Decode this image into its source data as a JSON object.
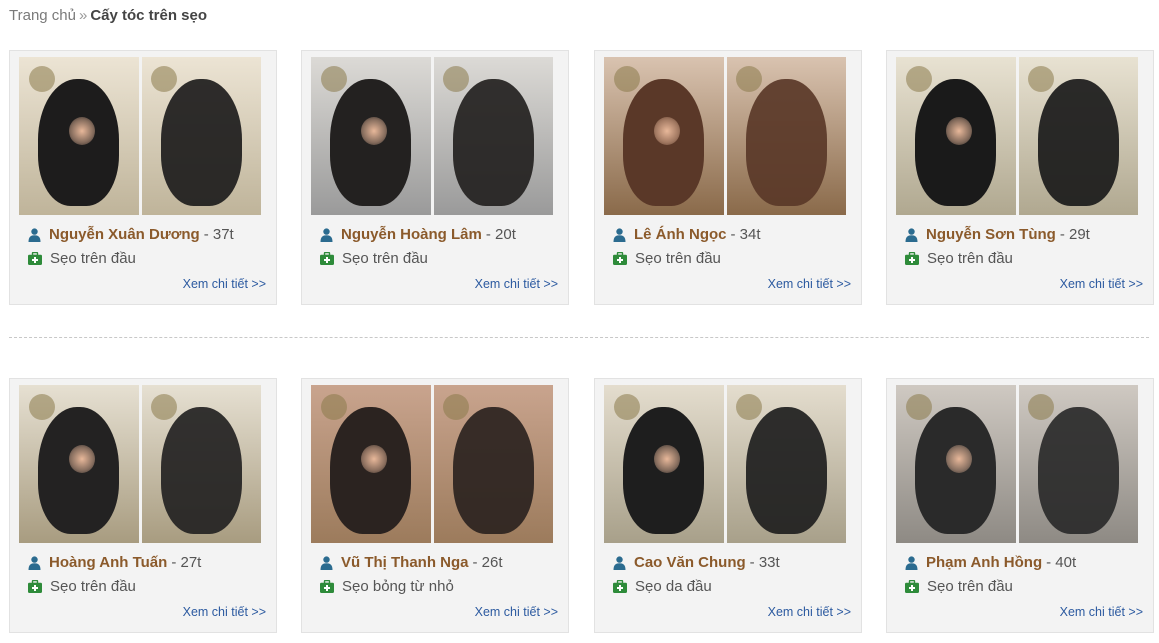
{
  "breadcrumb": {
    "home": "Trang chủ",
    "separator": "»",
    "current": "Cấy tóc trên sẹo"
  },
  "detail_label": "Xem chi tiết >>",
  "icons": {
    "person": "person-icon",
    "case": "medical-kit-icon"
  },
  "colors": {
    "name": "#8b5a2b",
    "link": "#2c5aa0",
    "icon": "#2b6b8f",
    "kit": "#2e8b3a"
  },
  "cases": [
    {
      "name": "Nguyễn Xuân Dương",
      "age": "- 37t",
      "type": "Sẹo trên đầu"
    },
    {
      "name": "Nguyễn Hoàng Lâm",
      "age": "- 20t",
      "type": "Sẹo trên đầu"
    },
    {
      "name": "Lê Ánh Ngọc",
      "age": "- 34t",
      "type": "Sẹo trên đầu"
    },
    {
      "name": "Nguyễn Sơn Tùng",
      "age": "- 29t",
      "type": "Sẹo trên đầu"
    },
    {
      "name": "Hoàng Anh Tuấn",
      "age": "- 27t",
      "type": "Sẹo trên đầu"
    },
    {
      "name": "Vũ Thị Thanh Nga",
      "age": "- 26t",
      "type": "Sẹo bỏng từ nhỏ"
    },
    {
      "name": "Cao Văn Chung",
      "age": "- 33t",
      "type": "Sẹo da đầu"
    },
    {
      "name": "Phạm Anh Hồng",
      "age": "- 40t",
      "type": "Sẹo trên đầu"
    }
  ]
}
